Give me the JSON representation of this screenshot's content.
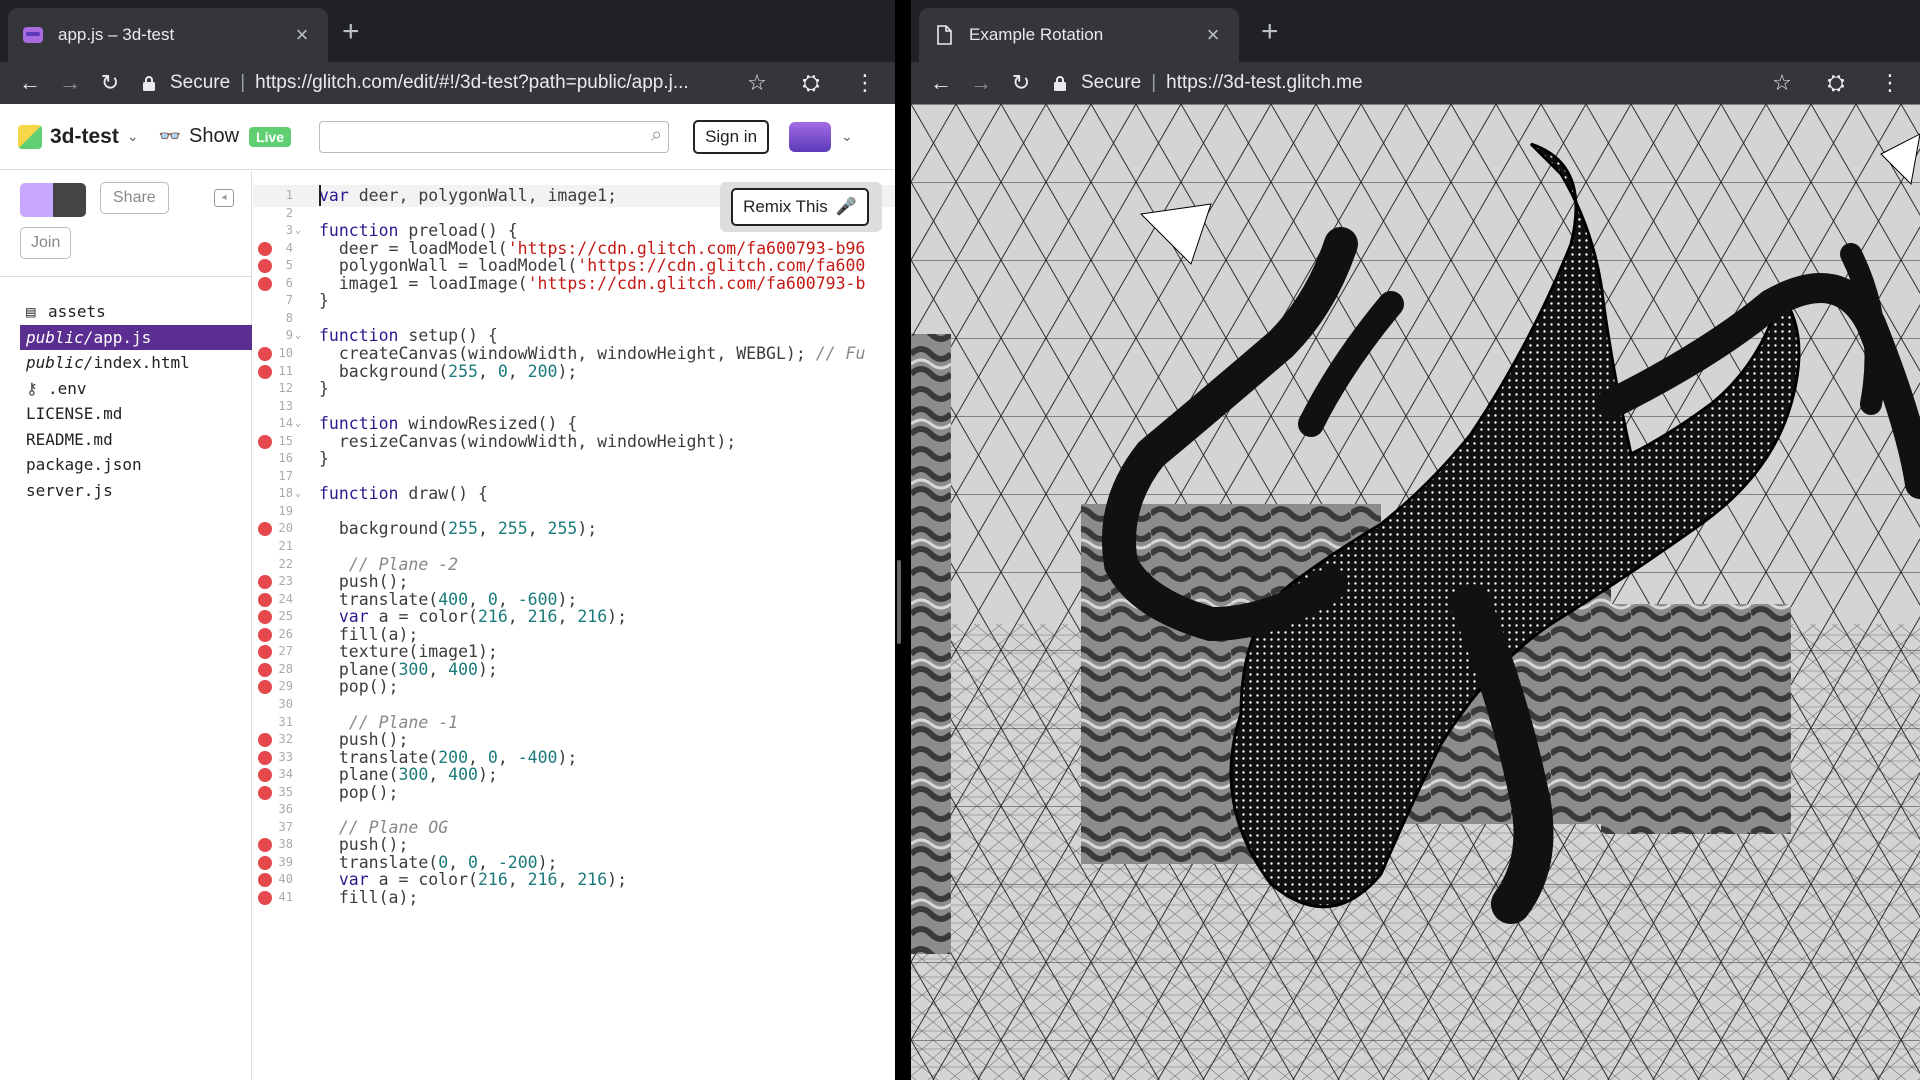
{
  "left_window": {
    "tab_title": "app.js – 3d-test",
    "secure_label": "Secure",
    "url": "https://glitch.com/edit/#!/3d-test?path=public/app.j..."
  },
  "right_window": {
    "tab_title": "Example Rotation",
    "secure_label": "Secure",
    "url": "https://3d-test.glitch.me"
  },
  "glitch": {
    "project_name": "3d-test",
    "show_label": "Show",
    "live_badge": "Live",
    "search_placeholder": "",
    "signin_label": "Sign in",
    "share_label": "Share",
    "join_label": "Join",
    "remix_label": "Remix This",
    "files": [
      {
        "dir": "",
        "name": "assets",
        "icon": "assets-icon"
      },
      {
        "dir": "public/",
        "name": "app.js",
        "active": true
      },
      {
        "dir": "public/",
        "name": "index.html"
      },
      {
        "dir": "",
        "name": ".env",
        "icon": "key-icon"
      },
      {
        "dir": "",
        "name": "LICENSE.md"
      },
      {
        "dir": "",
        "name": "README.md"
      },
      {
        "dir": "",
        "name": "package.json"
      },
      {
        "dir": "",
        "name": "server.js"
      }
    ]
  },
  "code_lines": [
    {
      "n": "1",
      "html": "<span class=\"kw\">var</span> deer, polygonWall, image1;",
      "cur": true
    },
    {
      "n": "2",
      "html": ""
    },
    {
      "n": "3",
      "fold": true,
      "html": "<span class=\"kw\">function</span> preload() {"
    },
    {
      "n": "4",
      "bp": true,
      "html": "  deer = loadModel(<span class=\"str\">'https://cdn.glitch.com/fa600793-b96</span>"
    },
    {
      "n": "5",
      "bp": true,
      "html": "  polygonWall = loadModel(<span class=\"str\">'https://cdn.glitch.com/fa600</span>"
    },
    {
      "n": "6",
      "bp": true,
      "html": "  image1 = loadImage(<span class=\"str\">'https://cdn.glitch.com/fa600793-b</span>"
    },
    {
      "n": "7",
      "html": "}"
    },
    {
      "n": "8",
      "html": ""
    },
    {
      "n": "9",
      "fold": true,
      "html": "<span class=\"kw\">function</span> setup() {"
    },
    {
      "n": "10",
      "bp": true,
      "html": "  createCanvas(windowWidth, windowHeight, WEBGL); <span class=\"cm\">// Fu</span>"
    },
    {
      "n": "11",
      "bp": true,
      "html": "  background(<span class=\"nm\">255</span>, <span class=\"nm\">0</span>, <span class=\"nm\">200</span>);"
    },
    {
      "n": "12",
      "html": "}"
    },
    {
      "n": "13",
      "html": ""
    },
    {
      "n": "14",
      "fold": true,
      "html": "<span class=\"kw\">function</span> windowResized() {"
    },
    {
      "n": "15",
      "bp": true,
      "html": "  resizeCanvas(windowWidth, windowHeight);"
    },
    {
      "n": "16",
      "html": "}"
    },
    {
      "n": "17",
      "html": ""
    },
    {
      "n": "18",
      "fold": true,
      "html": "<span class=\"kw\">function</span> draw() {"
    },
    {
      "n": "19",
      "html": ""
    },
    {
      "n": "20",
      "bp": true,
      "html": "  background(<span class=\"nm\">255</span>, <span class=\"nm\">255</span>, <span class=\"nm\">255</span>);"
    },
    {
      "n": "21",
      "html": ""
    },
    {
      "n": "22",
      "html": "   <span class=\"cm\">// Plane -2</span>"
    },
    {
      "n": "23",
      "bp": true,
      "html": "  push();"
    },
    {
      "n": "24",
      "bp": true,
      "html": "  translate(<span class=\"nm\">400</span>, <span class=\"nm\">0</span>, <span class=\"nm\">-600</span>);"
    },
    {
      "n": "25",
      "bp": true,
      "html": "  <span class=\"kw\">var</span> a = color(<span class=\"nm\">216</span>, <span class=\"nm\">216</span>, <span class=\"nm\">216</span>);"
    },
    {
      "n": "26",
      "bp": true,
      "html": "  fill(a);"
    },
    {
      "n": "27",
      "bp": true,
      "html": "  texture(image1);"
    },
    {
      "n": "28",
      "bp": true,
      "html": "  plane(<span class=\"nm\">300</span>, <span class=\"nm\">400</span>);"
    },
    {
      "n": "29",
      "bp": true,
      "html": "  pop();"
    },
    {
      "n": "30",
      "html": ""
    },
    {
      "n": "31",
      "html": "   <span class=\"cm\">// Plane -1</span>"
    },
    {
      "n": "32",
      "bp": true,
      "html": "  push();"
    },
    {
      "n": "33",
      "bp": true,
      "html": "  translate(<span class=\"nm\">200</span>, <span class=\"nm\">0</span>, <span class=\"nm\">-400</span>);"
    },
    {
      "n": "34",
      "bp": true,
      "html": "  plane(<span class=\"nm\">300</span>, <span class=\"nm\">400</span>);"
    },
    {
      "n": "35",
      "bp": true,
      "html": "  pop();"
    },
    {
      "n": "36",
      "html": ""
    },
    {
      "n": "37",
      "html": "  <span class=\"cm\">// Plane OG</span>"
    },
    {
      "n": "38",
      "bp": true,
      "html": "  push();"
    },
    {
      "n": "39",
      "bp": true,
      "html": "  translate(<span class=\"nm\">0</span>, <span class=\"nm\">0</span>, <span class=\"nm\">-200</span>);"
    },
    {
      "n": "40",
      "bp": true,
      "html": "  <span class=\"kw\">var</span> a = color(<span class=\"nm\">216</span>, <span class=\"nm\">216</span>, <span class=\"nm\">216</span>);"
    },
    {
      "n": "41",
      "bp": true,
      "html": "  fill(a);"
    }
  ],
  "colors": {
    "chrome_dark": "#202124",
    "chrome_toolbar": "#35363a",
    "glitch_active_file": "#5b2e91",
    "live_green": "#5fcf72",
    "breakpoint_red": "#e5484d"
  }
}
